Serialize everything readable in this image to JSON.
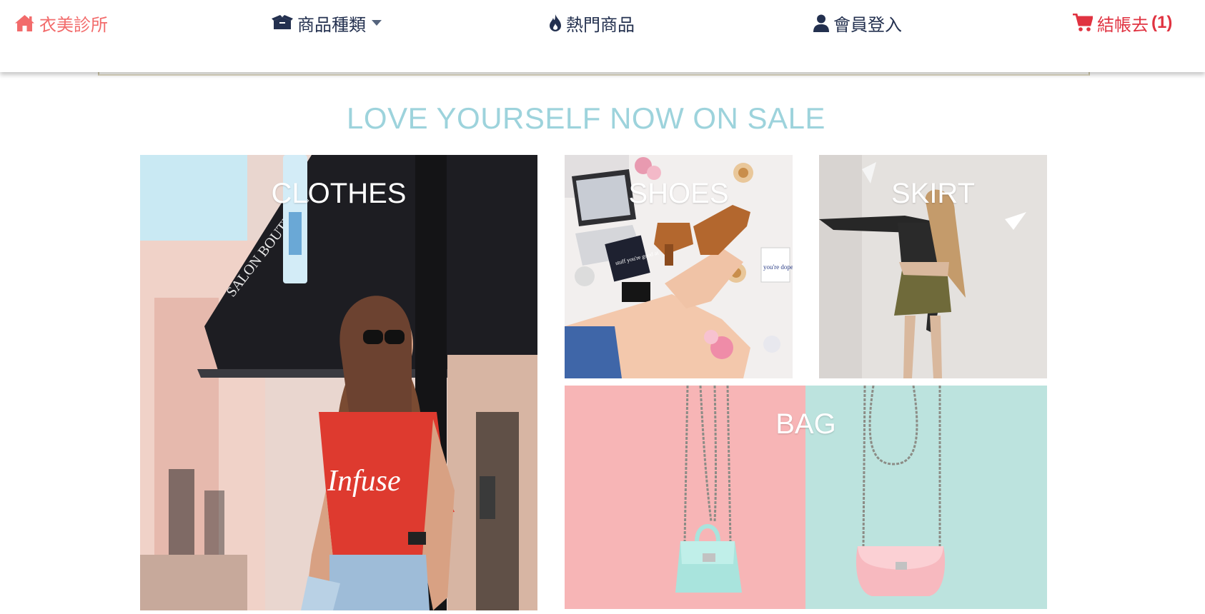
{
  "nav": {
    "brand": "衣美診所",
    "category": "商品種類",
    "hot": "熱門商品",
    "member": "會員登入",
    "cart_label": "結帳去",
    "cart_count": "(1)"
  },
  "headline": "LOVE YOURSELF NOW ON SALE",
  "tiles": {
    "clothes": "CLOTHES",
    "shoes": "SHOES",
    "skirt": "SKIRT",
    "bag": "BAG"
  },
  "photo_text": {
    "tshirt": "Infuse",
    "awning": "SALON BOUTIQUE",
    "card_left": "stuff you're good at",
    "card_right": "you're dope."
  },
  "colors": {
    "brand": "#f26b6b",
    "nav_text": "#23304f",
    "cart": "#e03341",
    "headline": "#9dd3dc"
  },
  "icons": {
    "brand": "home-icon",
    "category": "box-icon",
    "hot": "fire-icon",
    "member": "user-icon",
    "cart": "shopping-cart-icon"
  }
}
